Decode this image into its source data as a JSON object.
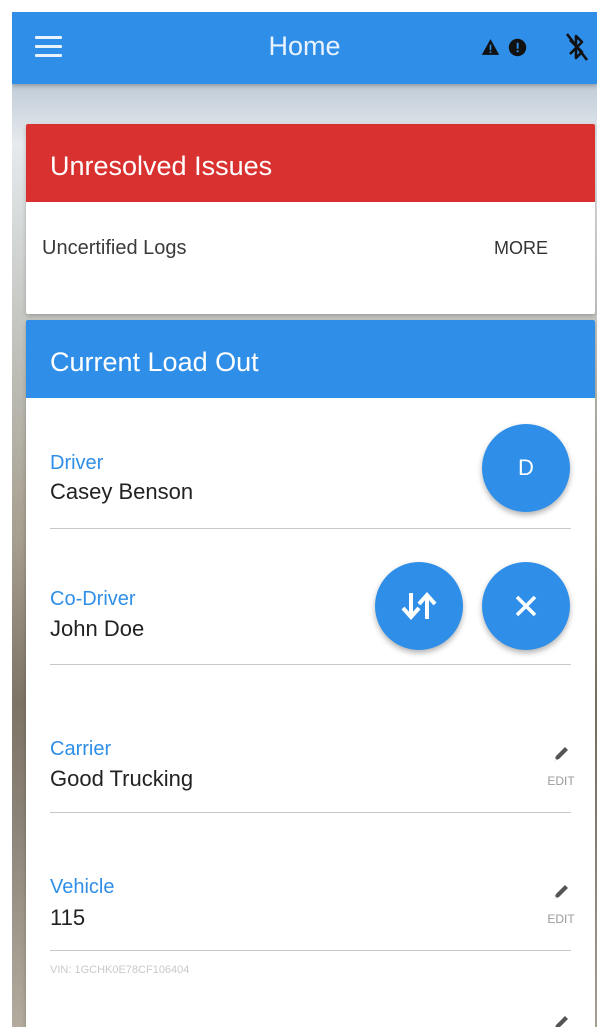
{
  "app_bar": {
    "title": "Home",
    "icons": [
      "menu-icon",
      "warning-icon",
      "info-icon",
      "bluetooth-disabled-icon"
    ]
  },
  "issues_card": {
    "title": "Unresolved Issues",
    "item_text": "Uncertified Logs",
    "more_label": "MORE"
  },
  "load_card": {
    "title": "Current Load Out",
    "driver": {
      "label": "Driver",
      "value": "Casey Benson",
      "avatar_letter": "D"
    },
    "co_driver": {
      "label": "Co-Driver",
      "value": "John Doe",
      "icons": [
        "swap-vertical-icon",
        "close-icon"
      ]
    },
    "carrier": {
      "label": "Carrier",
      "value": "Good Trucking",
      "edit_label": "EDIT"
    },
    "vehicle": {
      "label": "Vehicle",
      "value": "115",
      "edit_label": "EDIT",
      "vin": "VIN: 1GCHK0E78CF106404"
    }
  },
  "colors": {
    "primary": "#2f8fe8",
    "alert": "#d93030",
    "text": "#222222",
    "secondary_text": "#9a9a9a"
  }
}
